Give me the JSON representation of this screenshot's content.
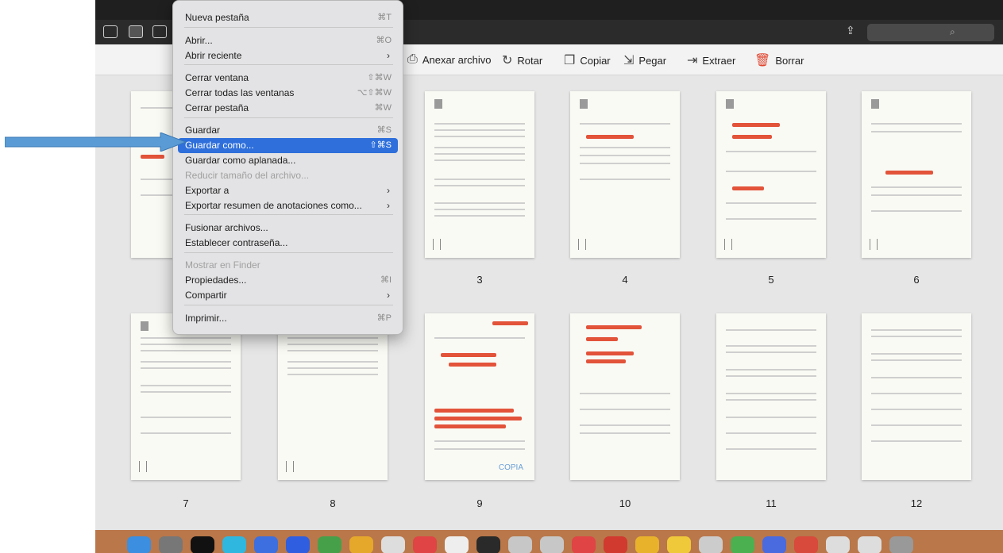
{
  "menu": {
    "items": [
      {
        "label": "Nueva pestaña",
        "shortcut": "⌘T",
        "submenu": false,
        "disabled": false,
        "highlight": false
      },
      {
        "label": "Abrir...",
        "shortcut": "⌘O",
        "submenu": false,
        "disabled": false,
        "highlight": false
      },
      {
        "label": "Abrir reciente",
        "shortcut": "",
        "submenu": true,
        "disabled": false,
        "highlight": false
      },
      {
        "label": "Cerrar ventana",
        "shortcut": "⇧⌘W",
        "submenu": false,
        "disabled": false,
        "highlight": false
      },
      {
        "label": "Cerrar todas las ventanas",
        "shortcut": "⌥⇧⌘W",
        "submenu": false,
        "disabled": false,
        "highlight": false
      },
      {
        "label": "Cerrar pestaña",
        "shortcut": "⌘W",
        "submenu": false,
        "disabled": false,
        "highlight": false
      },
      {
        "label": "Guardar",
        "shortcut": "⌘S",
        "submenu": false,
        "disabled": false,
        "highlight": false
      },
      {
        "label": "Guardar como...",
        "shortcut": "⇧⌘S",
        "submenu": false,
        "disabled": false,
        "highlight": true
      },
      {
        "label": "Guardar como aplanada...",
        "shortcut": "",
        "submenu": false,
        "disabled": false,
        "highlight": false
      },
      {
        "label": "Reducir tamaño del archivo...",
        "shortcut": "",
        "submenu": false,
        "disabled": true,
        "highlight": false
      },
      {
        "label": "Exportar a",
        "shortcut": "",
        "submenu": true,
        "disabled": false,
        "highlight": false
      },
      {
        "label": "Exportar resumen de anotaciones como...",
        "shortcut": "",
        "submenu": true,
        "disabled": false,
        "highlight": false
      },
      {
        "label": "Fusionar archivos...",
        "shortcut": "",
        "submenu": false,
        "disabled": false,
        "highlight": false
      },
      {
        "label": "Establecer contraseña...",
        "shortcut": "",
        "submenu": false,
        "disabled": false,
        "highlight": false
      },
      {
        "label": "Mostrar en Finder",
        "shortcut": "",
        "submenu": false,
        "disabled": true,
        "highlight": false
      },
      {
        "label": "Propiedades...",
        "shortcut": "⌘I",
        "submenu": false,
        "disabled": false,
        "highlight": false
      },
      {
        "label": "Compartir",
        "shortcut": "",
        "submenu": true,
        "disabled": false,
        "highlight": false
      },
      {
        "label": "Imprimir...",
        "shortcut": "⌘P",
        "submenu": false,
        "disabled": false,
        "highlight": false
      }
    ]
  },
  "toolbar": {
    "attach_label": "Anexar archivo",
    "rotate_label": "Rotar",
    "copy_label": "Copiar",
    "paste_label": "Pegar",
    "extract_label": "Extraer",
    "delete_label": "Borrar"
  },
  "pages": {
    "row1": [
      "",
      "",
      "3",
      "4",
      "5",
      "6"
    ],
    "row2": [
      "7",
      "8",
      "9",
      "10",
      "11",
      "12"
    ]
  },
  "page9_stamp": "COPIA",
  "colors": {
    "highlight": "#2e6fdb",
    "redaction": "#e2533a",
    "arrow": "#5b9bd5",
    "delete_icon": "#e0452f"
  },
  "icons": {
    "attach": "pdf-attach-icon",
    "rotate": "rotate-icon",
    "copy": "copy-icon",
    "paste": "paste-icon",
    "extract": "extract-icon",
    "delete": "trash-icon",
    "share": "share-icon",
    "search": "search-icon"
  }
}
